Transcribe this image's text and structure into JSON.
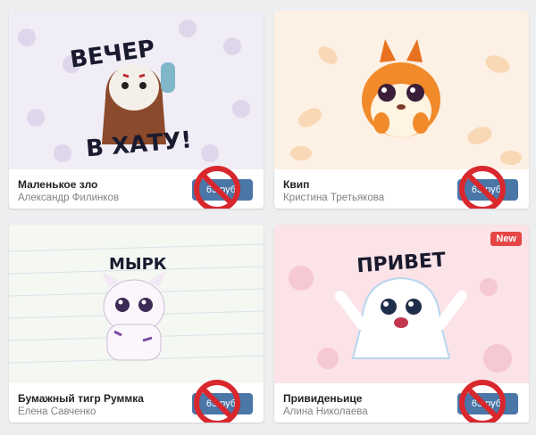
{
  "stickers": [
    {
      "title": "Маленькое зло",
      "author": "Александр Филинков",
      "price": "63 руб.",
      "caption_top": "ВЕЧЕР",
      "caption_bottom": "В ХАТУ!",
      "background": "#f1edf6"
    },
    {
      "title": "Квип",
      "author": "Кристина Третьякова",
      "price": "63 руб.",
      "background": "#fdf0e4"
    },
    {
      "title": "Бумажный тигр Руммка",
      "author": "Елена Савченко",
      "price": "63 руб.",
      "caption_top": "МЫРК",
      "background": "#f4f7f2"
    },
    {
      "title": "Привиденьице",
      "author": "Алина Николаева",
      "price": "63 руб.",
      "caption_top": "ПРИВЕТ",
      "badge": "New",
      "background": "#fbe3e8"
    }
  ],
  "colors": {
    "buy_button": "#4a76a8",
    "ban_sign": "#d8272d",
    "new_badge": "#e64646"
  },
  "icons": {
    "ban": "prohibited-sign-icon"
  }
}
